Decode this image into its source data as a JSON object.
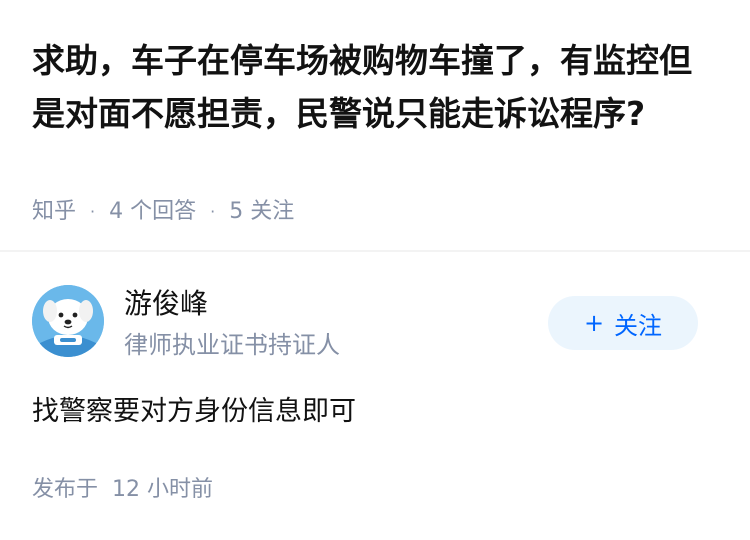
{
  "question": {
    "title": "求助，车子在停车场被购物车撞了，有监控但是对面不愿担责，民警说只能走诉讼程序?",
    "source": "知乎",
    "separator": "·",
    "answer_count": "4 个回答",
    "follow_count": "5 关注"
  },
  "answer": {
    "author": {
      "name": "游俊峰",
      "badge": "律师执业证书持证人",
      "avatar_icon": "cartoon-dog-avatar"
    },
    "follow_button": {
      "icon": "plus-icon",
      "plus": "+",
      "label": "关注"
    },
    "content": "找警察要对方身份信息即可",
    "published_prefix": "发布于",
    "published_time": "12 小时前"
  },
  "colors": {
    "title": "#121212",
    "meta": "#8590a6",
    "follow_bg": "#ebf5fd",
    "follow_text": "#0066ff",
    "avatar_bg": "#6ab8ea"
  }
}
